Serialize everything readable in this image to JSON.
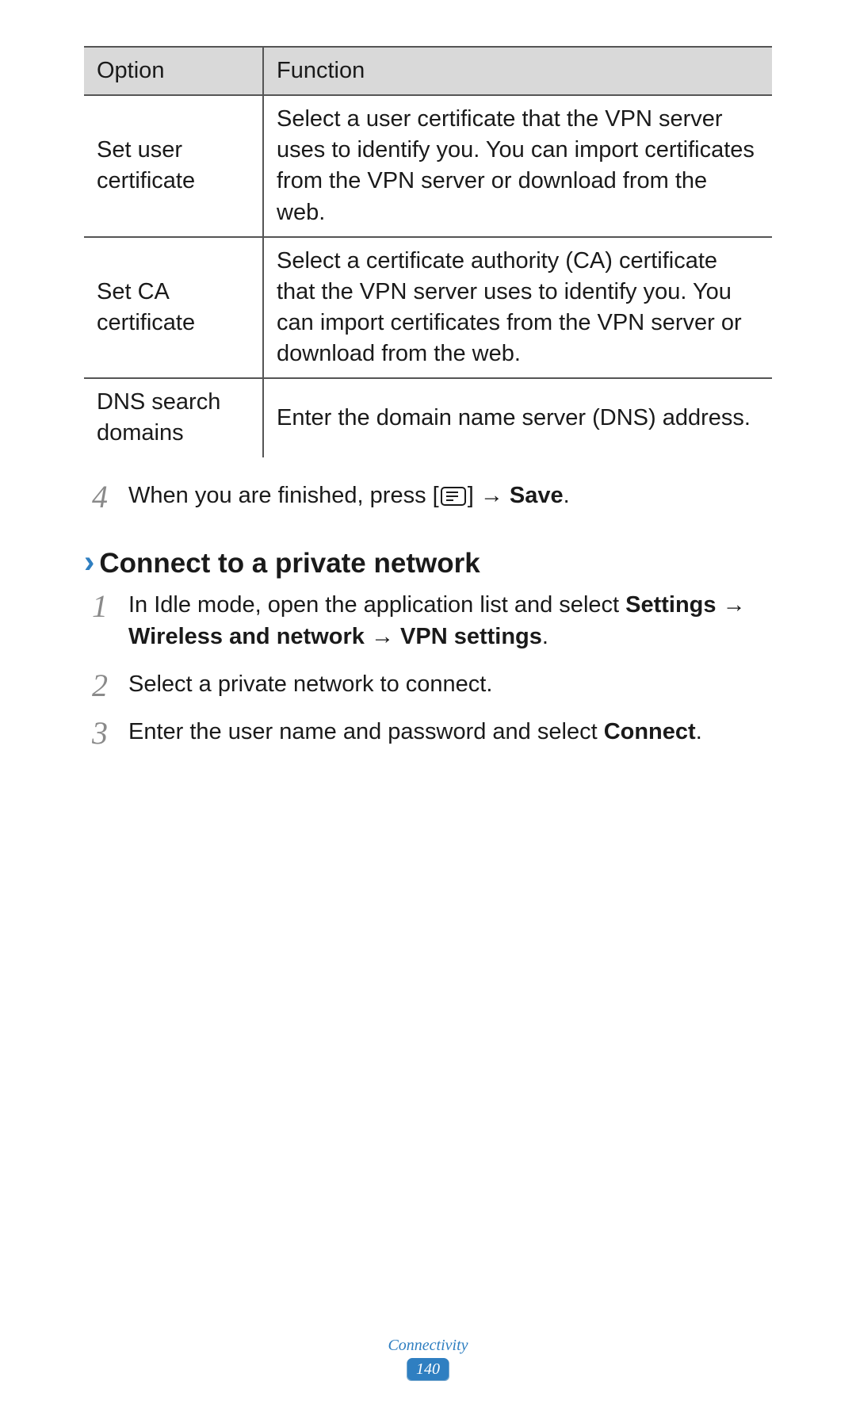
{
  "table": {
    "header": {
      "option": "Option",
      "function": "Function"
    },
    "rows": [
      {
        "option": "Set user certificate",
        "function": "Select a user certificate that the VPN server uses to identify you. You can import certificates from the VPN server or download from the web."
      },
      {
        "option": "Set CA certificate",
        "function": "Select a certificate authority (CA) certificate that the VPN server uses to identify you. You can import certificates from the VPN server or download from the web."
      },
      {
        "option": "DNS search domains",
        "function": "Enter the domain name server (DNS) address."
      }
    ]
  },
  "step4": {
    "num": "4",
    "pre": "When you are finished, press [",
    "post": "] → ",
    "save": "Save",
    "period": "."
  },
  "heading": "Connect to a private network",
  "steps": [
    {
      "num": "1",
      "pre": "In Idle mode, open the application list and select ",
      "b1": "Settings",
      "mid1": " → ",
      "b2": "Wireless and network",
      "mid2": " → ",
      "b3": "VPN settings",
      "post": "."
    },
    {
      "num": "2",
      "text": "Select a private network to connect."
    },
    {
      "num": "3",
      "pre": "Enter the user name and password and select ",
      "b1": "Connect",
      "post": "."
    }
  ],
  "footer": {
    "section": "Connectivity",
    "page": "140"
  }
}
